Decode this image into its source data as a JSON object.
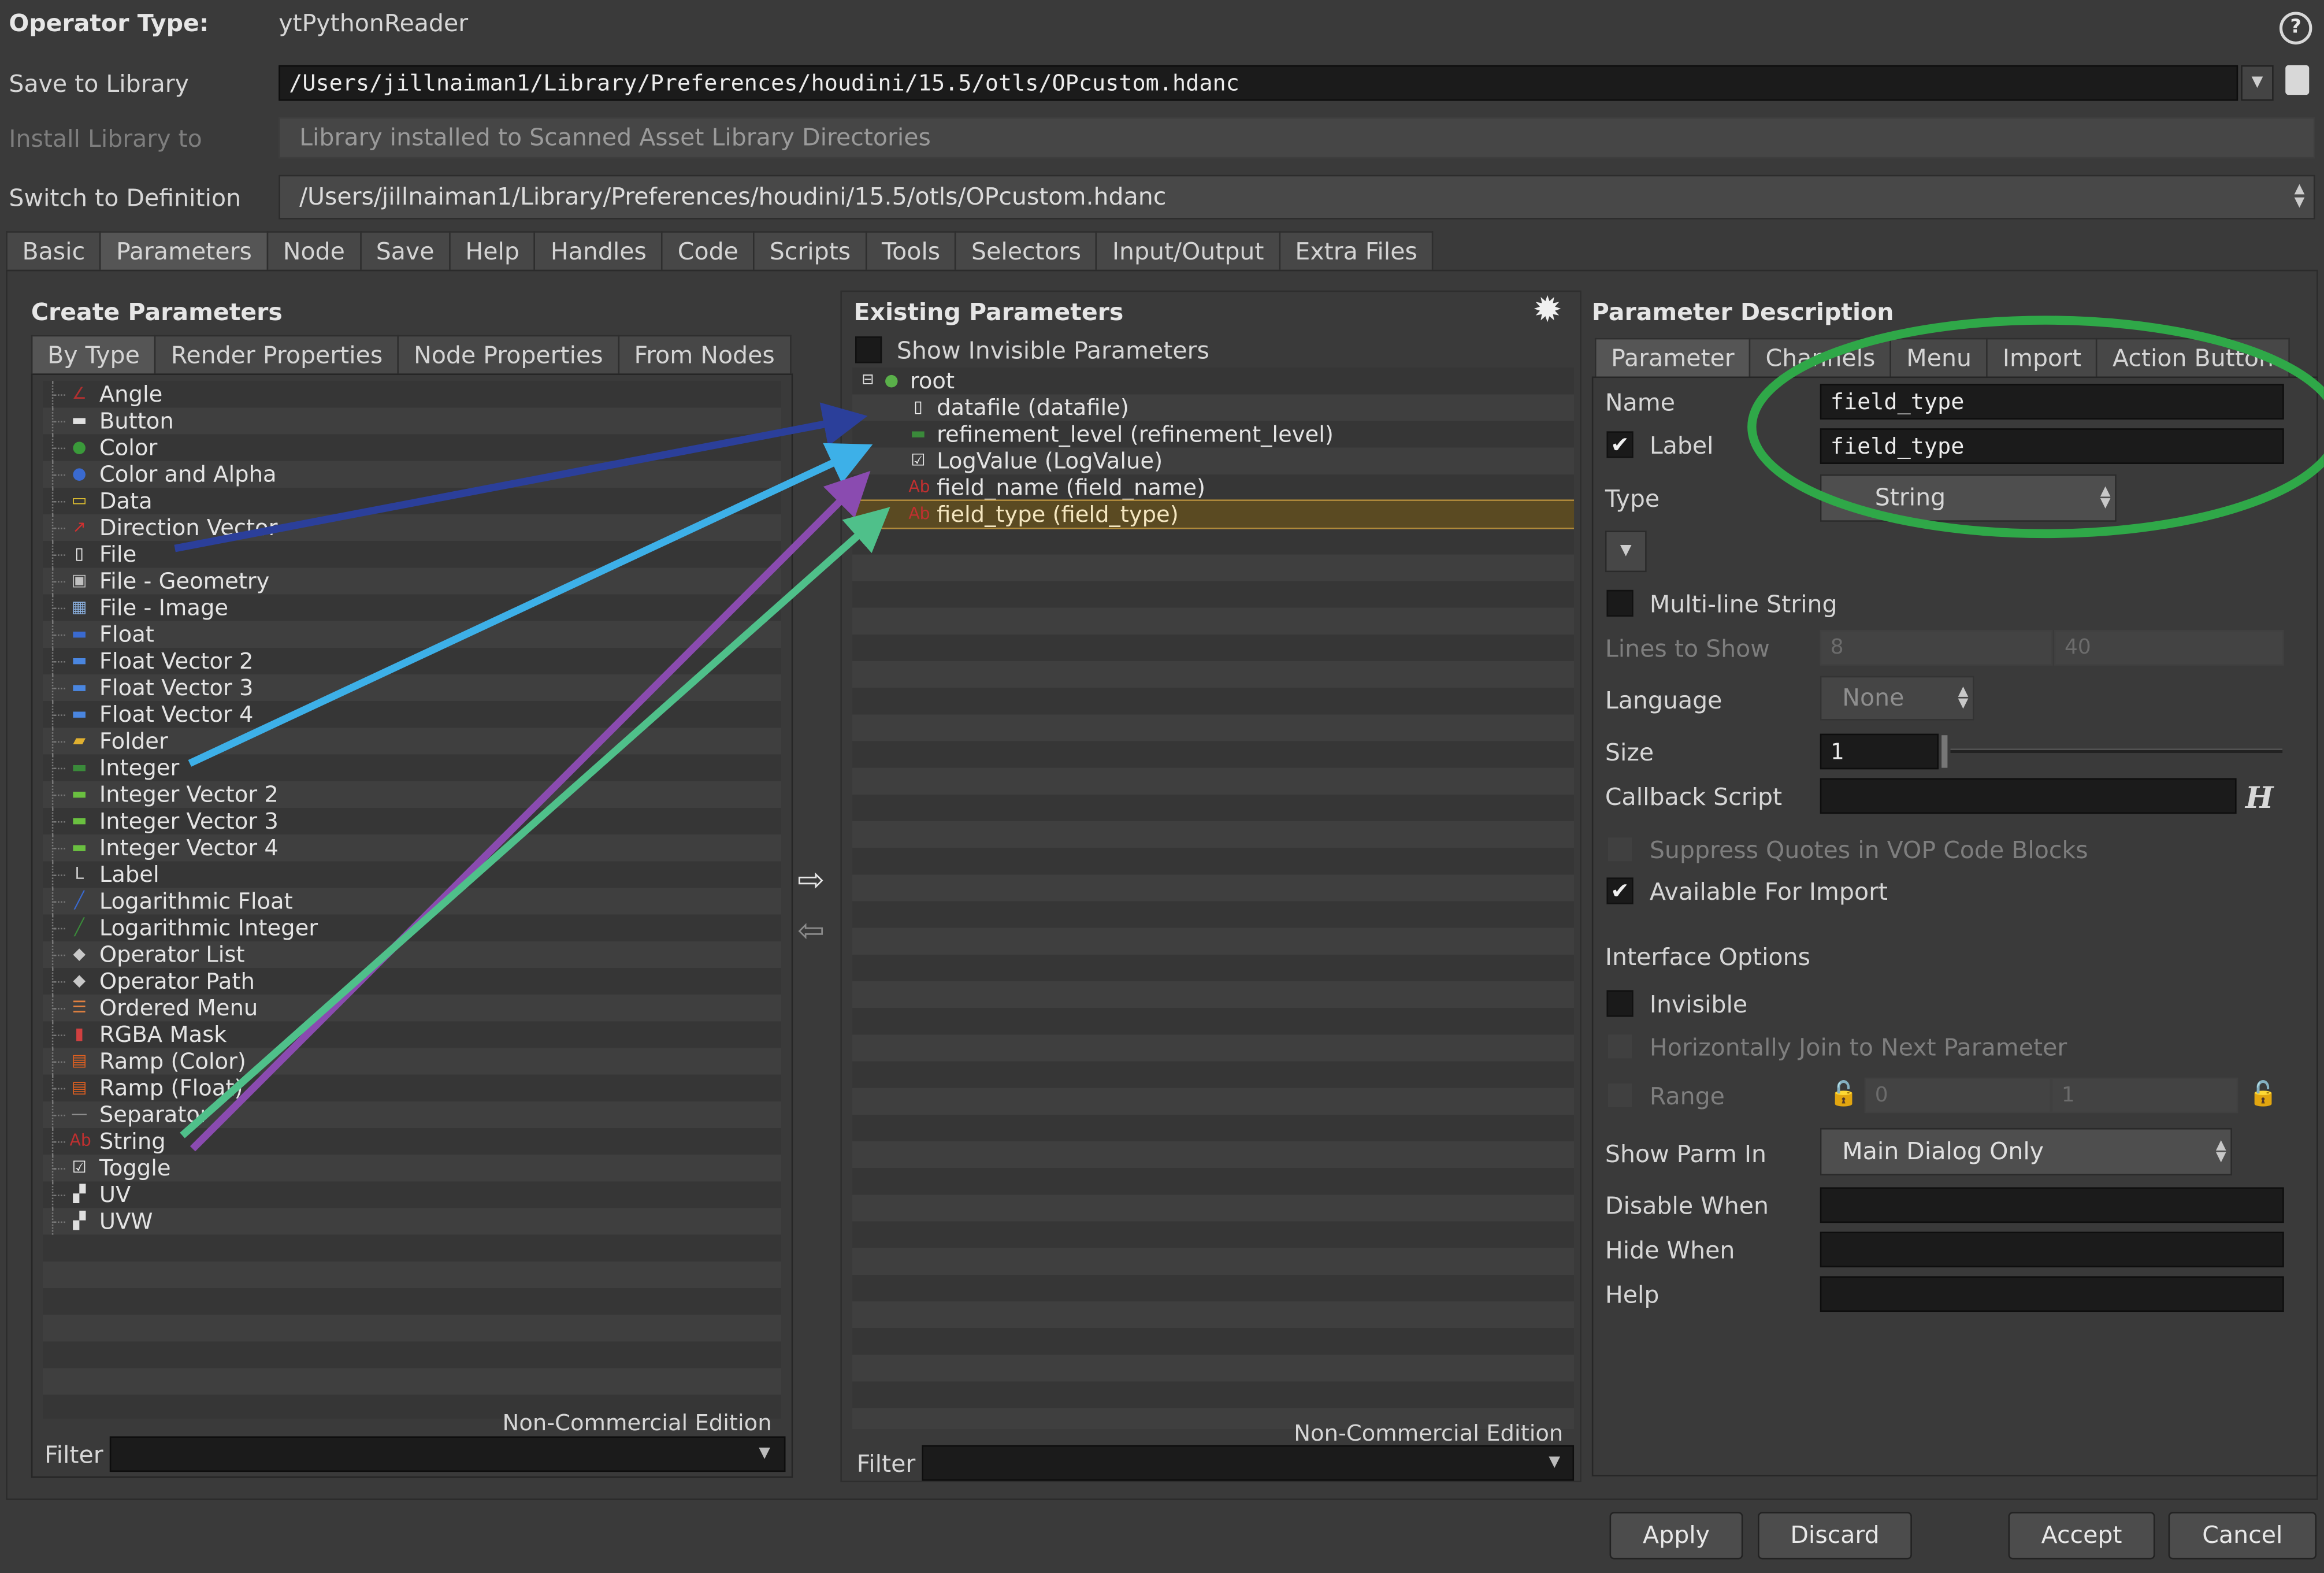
{
  "header": {
    "operator_type_label": "Operator Type:",
    "operator_type_value": "ytPythonReader",
    "save_to_library_label": "Save to Library",
    "save_to_library_value": "/Users/jillnaiman1/Library/Preferences/houdini/15.5/otls/OPcustom.hdanc",
    "install_library_label": "Install Library to",
    "install_library_value": "Library installed to Scanned Asset Library Directories",
    "switch_definition_label": "Switch to Definition",
    "switch_definition_value": "/Users/jillnaiman1/Library/Preferences/houdini/15.5/otls/OPcustom.hdanc",
    "help_icon": "?"
  },
  "main_tabs": [
    "Basic",
    "Parameters",
    "Node",
    "Save",
    "Help",
    "Handles",
    "Code",
    "Scripts",
    "Tools",
    "Selectors",
    "Input/Output",
    "Extra Files"
  ],
  "create_parameters": {
    "title": "Create Parameters",
    "tabs": [
      "By Type",
      "Render Properties",
      "Node Properties",
      "From Nodes"
    ],
    "items": [
      {
        "label": "Angle",
        "icon": "angle-icon",
        "color": "#b03030"
      },
      {
        "label": "Button",
        "icon": "button-icon",
        "color": "#e0e0e0"
      },
      {
        "label": "Color",
        "icon": "color-icon",
        "color": "#3a9a3a"
      },
      {
        "label": "Color and Alpha",
        "icon": "color-alpha-icon",
        "color": "#3a6ad0"
      },
      {
        "label": "Data",
        "icon": "data-icon",
        "color": "#e0c030"
      },
      {
        "label": "Direction Vector",
        "icon": "direction-vector-icon",
        "color": "#d03030"
      },
      {
        "label": "File",
        "icon": "file-icon",
        "color": "#f0f0f0"
      },
      {
        "label": "File - Geometry",
        "icon": "file-geometry-icon",
        "color": "#c0c0c0"
      },
      {
        "label": "File - Image",
        "icon": "file-image-icon",
        "color": "#8ab0e0"
      },
      {
        "label": "Float",
        "icon": "float-icon",
        "color": "#3a6ad0"
      },
      {
        "label": "Float Vector 2",
        "icon": "float-vector2-icon",
        "color": "#4a86e0"
      },
      {
        "label": "Float Vector 3",
        "icon": "float-vector3-icon",
        "color": "#4a86e0"
      },
      {
        "label": "Float Vector 4",
        "icon": "float-vector4-icon",
        "color": "#4a86e0"
      },
      {
        "label": "Folder",
        "icon": "folder-icon",
        "color": "#e0b030"
      },
      {
        "label": "Integer",
        "icon": "integer-icon",
        "color": "#3a8a3a"
      },
      {
        "label": "Integer Vector 2",
        "icon": "integer-vector2-icon",
        "color": "#6ac040"
      },
      {
        "label": "Integer Vector 3",
        "icon": "integer-vector3-icon",
        "color": "#6ac040"
      },
      {
        "label": "Integer Vector 4",
        "icon": "integer-vector4-icon",
        "color": "#6ac040"
      },
      {
        "label": "Label",
        "icon": "label-icon",
        "color": "#c8c8c8"
      },
      {
        "label": "Logarithmic Float",
        "icon": "log-float-icon",
        "color": "#3a6ad0"
      },
      {
        "label": "Logarithmic Integer",
        "icon": "log-integer-icon",
        "color": "#3a8a3a"
      },
      {
        "label": "Operator List",
        "icon": "operator-list-icon",
        "color": "#c8c8c8"
      },
      {
        "label": "Operator Path",
        "icon": "operator-path-icon",
        "color": "#c8c8c8"
      },
      {
        "label": "Ordered Menu",
        "icon": "ordered-menu-icon",
        "color": "#e08040"
      },
      {
        "label": "RGBA Mask",
        "icon": "rgba-mask-icon",
        "color": "#d04040"
      },
      {
        "label": "Ramp (Color)",
        "icon": "ramp-color-icon",
        "color": "#e06020"
      },
      {
        "label": "Ramp (Float)",
        "icon": "ramp-float-icon",
        "color": "#e06020"
      },
      {
        "label": "Separator",
        "icon": "separator-icon",
        "color": "#909090"
      },
      {
        "label": "String",
        "icon": "string-icon",
        "color": "#c03030"
      },
      {
        "label": "Toggle",
        "icon": "toggle-icon",
        "color": "#f0f0f0"
      },
      {
        "label": "UV",
        "icon": "uv-icon",
        "color": "#e0e0e0"
      },
      {
        "label": "UVW",
        "icon": "uvw-icon",
        "color": "#e0e0e0"
      }
    ],
    "watermark": "Non-Commercial Edition",
    "filter_label": "Filter",
    "filter_value": ""
  },
  "existing_parameters": {
    "title": "Existing Parameters",
    "show_invisible_label": "Show Invisible Parameters",
    "tree": [
      {
        "label": "root",
        "icon": "root-icon",
        "level": 0,
        "selected": false
      },
      {
        "label": "datafile (datafile)",
        "icon": "file-icon",
        "level": 1,
        "selected": false
      },
      {
        "label": "refinement_level (refinement_level)",
        "icon": "integer-icon",
        "level": 1,
        "selected": false
      },
      {
        "label": "LogValue (LogValue)",
        "icon": "toggle-icon",
        "level": 1,
        "selected": false
      },
      {
        "label": "field_name (field_name)",
        "icon": "string-icon",
        "level": 1,
        "selected": false
      },
      {
        "label": "field_type (field_type)",
        "icon": "string-icon",
        "level": 1,
        "selected": true
      }
    ],
    "watermark": "Non-Commercial Edition",
    "filter_label": "Filter",
    "filter_value": "",
    "gear_icon": "gear-icon"
  },
  "parameter_description": {
    "title": "Parameter Description",
    "tabs": [
      "Parameter",
      "Channels",
      "Menu",
      "Import",
      "Action Button"
    ],
    "name_label": "Name",
    "name_value": "field_type",
    "label_label": "Label",
    "label_value": "field_type",
    "label_checked": true,
    "type_label": "Type",
    "type_value": "String",
    "multiline_label": "Multi-line String",
    "multiline_checked": false,
    "lines_to_show_label": "Lines to Show",
    "lines_min": "8",
    "lines_max": "40",
    "language_label": "Language",
    "language_value": "None",
    "size_label": "Size",
    "size_value": "1",
    "callback_label": "Callback Script",
    "callback_value": "",
    "callback_icon": "H",
    "suppress_quotes_label": "Suppress Quotes in VOP Code Blocks",
    "available_import_label": "Available For Import",
    "available_import_checked": true,
    "interface_options_label": "Interface Options",
    "invisible_label": "Invisible",
    "horizontally_join_label": "Horizontally Join to Next Parameter",
    "range_label": "Range",
    "range_min": "0",
    "range_max": "1",
    "show_parm_in_label": "Show Parm In",
    "show_parm_in_value": "Main Dialog Only",
    "disable_when_label": "Disable When",
    "disable_when_value": "",
    "hide_when_label": "Hide When",
    "hide_when_value": "",
    "help_label": "Help",
    "help_value": ""
  },
  "footer": {
    "apply": "Apply",
    "discard": "Discard",
    "accept": "Accept",
    "cancel": "Cancel"
  },
  "annotations": {
    "arrow_colors": [
      "#2b3f9a",
      "#3db0e8",
      "#8a4bb0",
      "#4fc08a"
    ],
    "ellipse_color": "#2fa848"
  }
}
